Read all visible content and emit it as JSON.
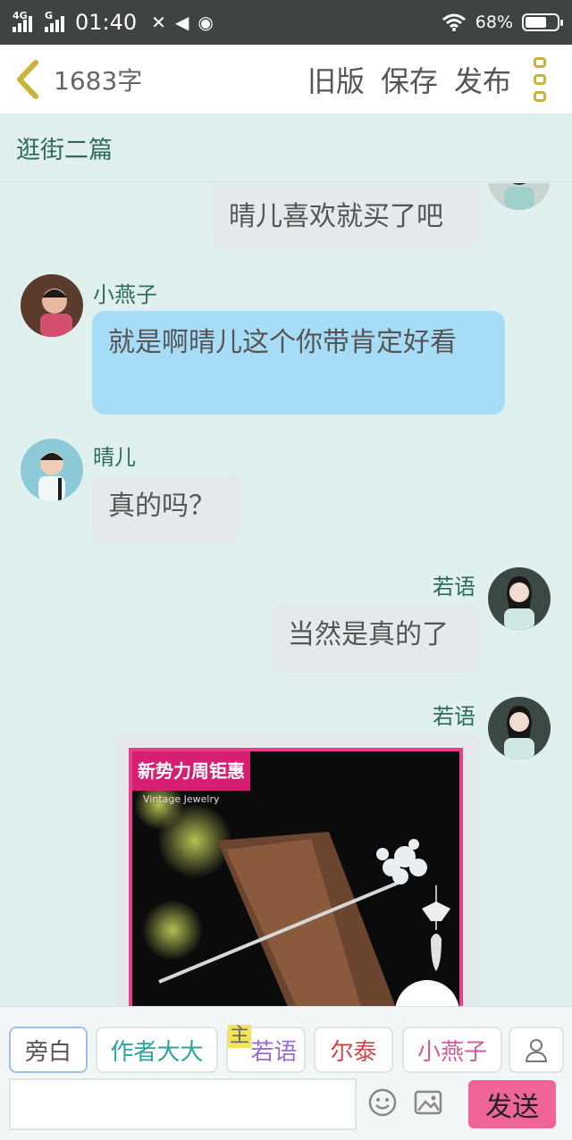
{
  "status_bar": {
    "network1": "4G",
    "network2": "G",
    "time": "01:40",
    "battery": "68%",
    "battery_level": 0.68
  },
  "toolbar": {
    "word_count": "1683字",
    "old_version": "旧版",
    "save": "保存",
    "publish": "发布"
  },
  "chapter": {
    "title": "逛街二篇"
  },
  "messages": [
    {
      "text": "晴儿喜欢就买了吧",
      "side": "right"
    },
    {
      "name": "小燕子",
      "text": "就是啊晴儿这个你带肯定好看",
      "side": "left"
    },
    {
      "name": "晴儿",
      "text": "真的吗？",
      "side": "left"
    },
    {
      "name": "若语",
      "text": "当然是真的了",
      "side": "right"
    },
    {
      "name": "若语",
      "side": "right",
      "image": {
        "banner": "新势力周钜惠",
        "brand_line": "Vintage Jewelry"
      }
    }
  ],
  "role_chips": [
    {
      "label": "旁白",
      "color": "#555555"
    },
    {
      "label": "作者大大",
      "color": "#2aa4a0"
    },
    {
      "label": "若语",
      "color": "#a06ad6",
      "tag": "主"
    },
    {
      "label": "尔泰",
      "color": "#d34545"
    },
    {
      "label": "小燕子",
      "color": "#d05a9a"
    }
  ],
  "input": {
    "placeholder": ""
  },
  "send_label": "发送",
  "colors": {
    "send_button": "#f0649a",
    "accent_green": "#2e6b5c",
    "bubble_blue": "#a7dcf7"
  }
}
